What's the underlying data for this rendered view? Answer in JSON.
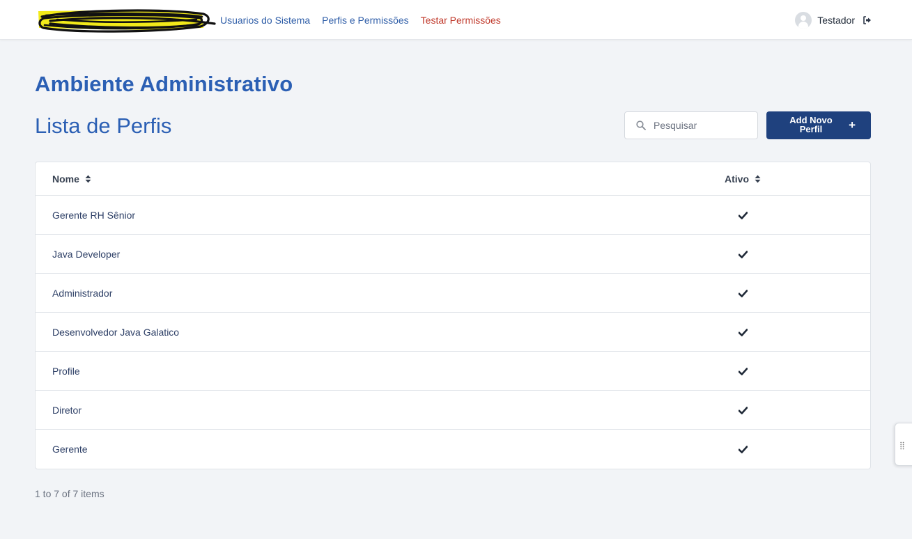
{
  "nav": {
    "links": [
      {
        "label": "Usuarios do Sistema",
        "active": false
      },
      {
        "label": "Perfis e Permissões",
        "active": false
      },
      {
        "label": "Testar Permissões",
        "active": true
      }
    ],
    "user_name": "Testador",
    "link_color": "#2f5ea8",
    "active_color": "#c0392b"
  },
  "page": {
    "title": "Ambiente Administrativo",
    "subtitle": "Lista de Perfis"
  },
  "search": {
    "placeholder": "Pesquisar",
    "value": ""
  },
  "add_button": {
    "label": "Add Novo Perfil",
    "color": "#1f417e"
  },
  "table": {
    "columns": [
      "Nome",
      "Ativo"
    ],
    "rows": [
      {
        "nome": "Gerente RH Sênior",
        "ativo": true
      },
      {
        "nome": "Java Developer",
        "ativo": true
      },
      {
        "nome": "Administrador",
        "ativo": true
      },
      {
        "nome": "Desenvolvedor Java Galatico",
        "ativo": true
      },
      {
        "nome": "Profile",
        "ativo": true
      },
      {
        "nome": "Diretor",
        "ativo": true
      },
      {
        "nome": "Gerente",
        "ativo": true
      }
    ]
  },
  "pagination": {
    "summary": "1 to 7 of 7 items"
  },
  "icons": {
    "logo": "logo-scribble",
    "avatar": "user-avatar-icon",
    "logout": "logout-icon",
    "search": "search-icon",
    "sort": "sort-icon",
    "check": "check-icon",
    "plus": "plus-icon",
    "grip": "grip-icon"
  },
  "colors": {
    "heading": "#2b5fb4",
    "background": "#f2f4f7"
  }
}
